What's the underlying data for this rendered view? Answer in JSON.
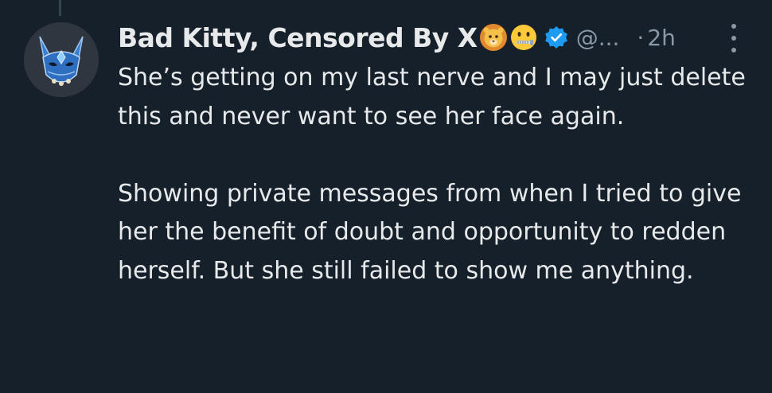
{
  "tweet": {
    "display_name": "Bad Kitty, Censored By X",
    "name_emojis": [
      "lion-face-icon",
      "zipper-mouth-face-icon"
    ],
    "verified_icon": "verified-badge-icon",
    "handle": "@...",
    "separator": "·",
    "time": "2h",
    "more_icon": "more-options-icon",
    "avatar_icon": "blue-cat-mask-avatar",
    "paragraphs": [
      "She’s getting on my last nerve and I may just delete this and never want to see her face again.",
      "Showing private messages from when I tried to give her the benefit of doubt and opportunity to redden herself. But she still failed to show me anything."
    ]
  },
  "colors": {
    "background": "#15202b",
    "text_primary": "#e7e9ea",
    "text_secondary": "#8b98a5",
    "verified_blue": "#1d9bf0",
    "thread_line": "#38444d"
  }
}
